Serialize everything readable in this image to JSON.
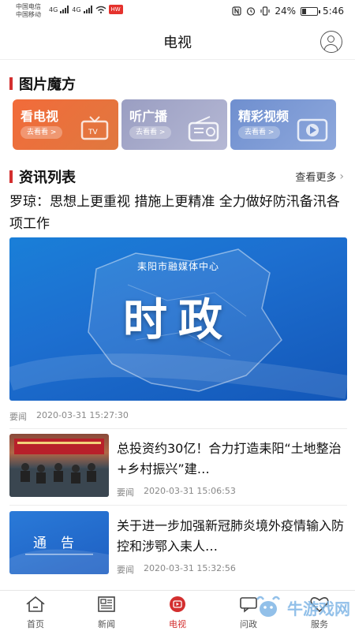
{
  "status_bar": {
    "carrier_1": "中国电信",
    "carrier_2": "中国移动",
    "net_1": "4G",
    "net_2": "4G",
    "hw_badge": "HW",
    "battery_percent": "24%",
    "time": "5:46"
  },
  "header": {
    "title": "电视"
  },
  "picture_cube": {
    "heading": "图片魔方",
    "cards": [
      {
        "title": "看电视",
        "sub": "去看看 >",
        "icon": "tv-icon",
        "color": "#f26b3a"
      },
      {
        "title": "听广播",
        "sub": "去看看 >",
        "icon": "radio-icon",
        "color": "#9a9ec2"
      },
      {
        "title": "精彩视频",
        "sub": "去看看 >",
        "icon": "video-play-icon",
        "color": "#6f8fcf"
      }
    ]
  },
  "news_list": {
    "heading": "资讯列表",
    "more_label": "查看更多",
    "featured": {
      "title": "罗琼：思想上更重视 措施上更精准 全力做好防汛备汛各项工作",
      "image_caption": "耒阳市融媒体中心",
      "image_big_text": "时政",
      "tag": "要闻",
      "time": "2020-03-31 15:27:30"
    },
    "items": [
      {
        "title": "总投资约30亿！合力打造耒阳“土地整治+乡村振兴”建…",
        "tag": "要闻",
        "time": "2020-03-31 15:06:53",
        "thumb_text": ""
      },
      {
        "title": "关于进一步加强新冠肺炎境外疫情输入防控和涉鄂入耒人…",
        "tag": "要闻",
        "time": "2020-03-31 15:32:56",
        "thumb_text": "通告"
      }
    ]
  },
  "bottom_nav": [
    {
      "label": "首页",
      "icon": "home-icon"
    },
    {
      "label": "新闻",
      "icon": "news-icon"
    },
    {
      "label": "电视",
      "icon": "tv-play-icon",
      "active": true
    },
    {
      "label": "问政",
      "icon": "chat-icon"
    },
    {
      "label": "服务",
      "icon": "heart-icon"
    }
  ],
  "watermark": {
    "text": "牛游戏网"
  },
  "colors": {
    "accent": "#d32f2f",
    "tv_card": "#f26b3a",
    "radio_card": "#9a9ec2",
    "video_card": "#6f8fcf",
    "hero_blue": "#1a7fd8"
  }
}
